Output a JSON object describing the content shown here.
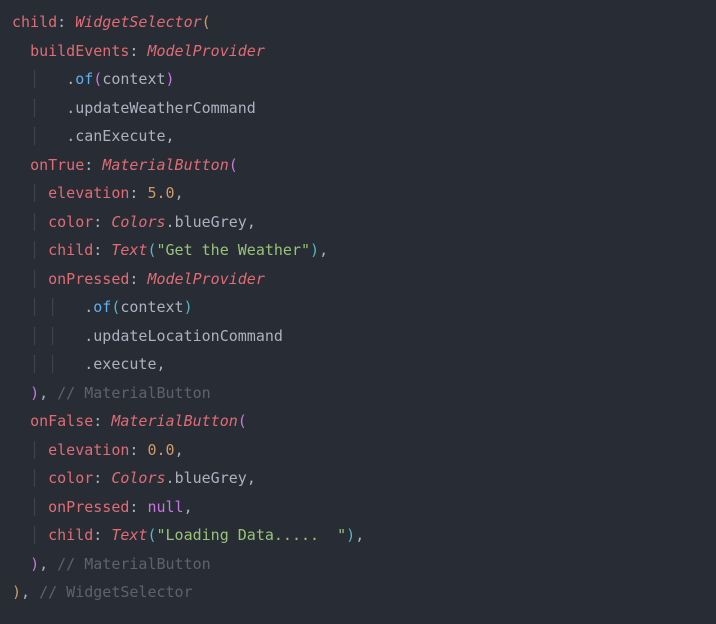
{
  "code": {
    "l1_child": "child",
    "l1_widgetselector": "WidgetSelector",
    "l2_buildevents": "buildEvents",
    "l2_modelprovider": "ModelProvider",
    "l3_of": "of",
    "l3_context": "context",
    "l4_updateweather": "updateWeatherCommand",
    "l5_canexecute": "canExecute",
    "l6_ontrue": "onTrue",
    "l6_materialbutton": "MaterialButton",
    "l7_elevation": "elevation",
    "l7_val": "5.0",
    "l8_color": "color",
    "l8_colors": "Colors",
    "l8_bluegrey": "blueGrey",
    "l9_child": "child",
    "l9_text": "Text",
    "l9_str": "\"Get the Weather\"",
    "l10_onpressed": "onPressed",
    "l10_modelprovider": "ModelProvider",
    "l11_of": "of",
    "l11_context": "context",
    "l12_updatelocation": "updateLocationCommand",
    "l13_execute": "execute",
    "l14_comment": "// MaterialButton",
    "l15_onfalse": "onFalse",
    "l15_materialbutton": "MaterialButton",
    "l16_elevation": "elevation",
    "l16_val": "0.0",
    "l17_color": "color",
    "l17_colors": "Colors",
    "l17_bluegrey": "blueGrey",
    "l18_onpressed": "onPressed",
    "l18_null": "null",
    "l19_child": "child",
    "l19_text": "Text",
    "l19_str": "\"Loading Data.....  \"",
    "l20_comment": "// MaterialButton",
    "l21_comment": "// WidgetSelector"
  }
}
